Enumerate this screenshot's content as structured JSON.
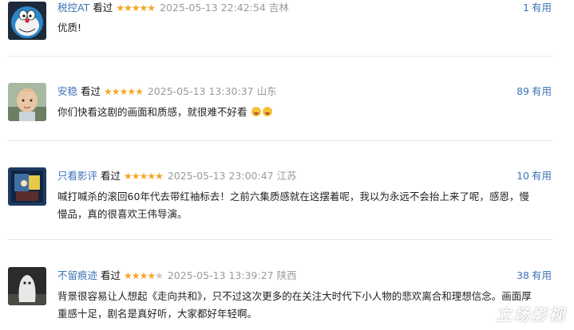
{
  "reviews": [
    {
      "user": "税控AT",
      "status": "看过",
      "rating": 5,
      "time": "2025-05-13 22:42:54",
      "location": "吉林",
      "useful_count": "1",
      "useful_label": "有用",
      "content": "优质!",
      "avatar": "doraemon-avatar"
    },
    {
      "user": "安稳",
      "status": "看过",
      "rating": 5,
      "time": "2025-05-13 13:30:37",
      "location": "山东",
      "useful_count": "89",
      "useful_label": "有用",
      "content": "你们快看这剧的画面和质感，就很难不好看",
      "avatar": "child-photo-avatar"
    },
    {
      "user": "只看影评",
      "status": "看过",
      "rating": 5,
      "time": "2025-05-13 23:00:47",
      "location": "江苏",
      "useful_count": "10",
      "useful_label": "有用",
      "content": "喊打喊杀的滚回60年代去带红袖标去！之前六集质感就在这摆着呢，我以为永远不会抬上来了呢，感恩，慢慢品，真的很喜欢王伟导演。",
      "avatar": "painting-avatar"
    },
    {
      "user": "不留痕迹",
      "status": "看过",
      "rating": 4,
      "time": "2025-05-13 13:39:27",
      "location": "陕西",
      "useful_count": "38",
      "useful_label": "有用",
      "content": "背景很容易让人想起《走向共和》，只不过这次更多的在关注大时代下小人物的悲欢离合和理想信念。画面厚重感十足，剧名是真好听，大家都好年轻啊。",
      "avatar": "ghost-avatar"
    }
  ],
  "watermark": "立场影视",
  "colors": {
    "link": "#3d73b8",
    "star": "#f5a623",
    "meta": "#9a9a9a",
    "divider": "#e8e8e8"
  }
}
